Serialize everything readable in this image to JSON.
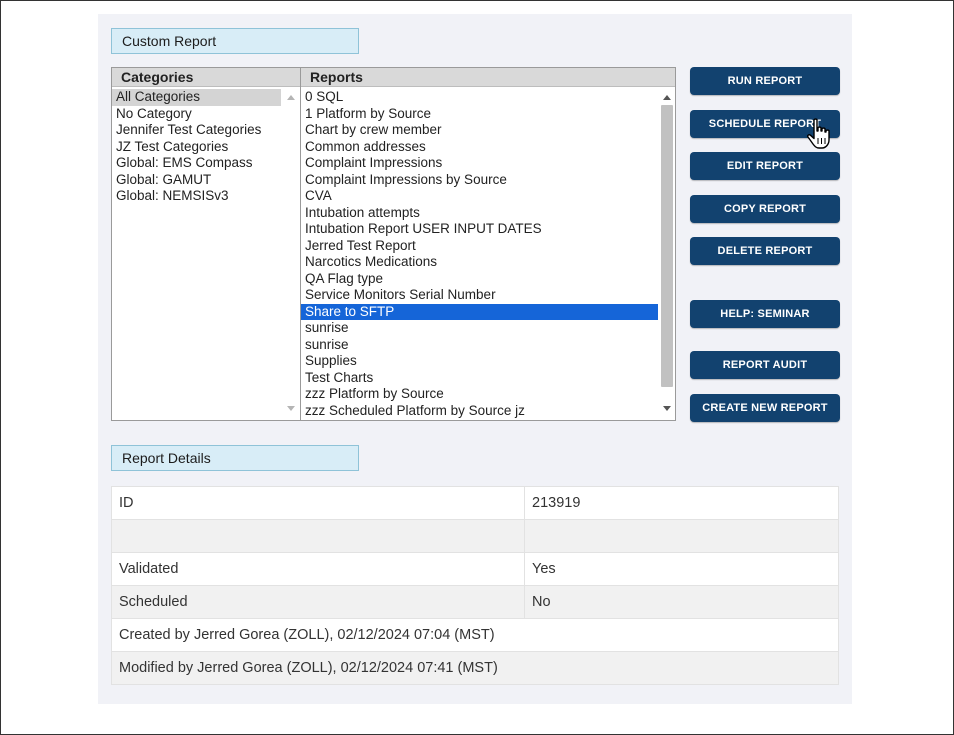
{
  "custom_report": {
    "header": "Custom Report",
    "categories_header": "Categories",
    "reports_header": "Reports",
    "categories": [
      {
        "label": "All Categories",
        "selected": true
      },
      {
        "label": "No Category"
      },
      {
        "label": "Jennifer Test Categories"
      },
      {
        "label": "JZ Test Categories"
      },
      {
        "label": "Global: EMS Compass"
      },
      {
        "label": "Global: GAMUT"
      },
      {
        "label": "Global: NEMSISv3"
      }
    ],
    "reports": [
      {
        "label": "0 SQL"
      },
      {
        "label": "1 Platform by Source"
      },
      {
        "label": "Chart by crew member"
      },
      {
        "label": "Common addresses"
      },
      {
        "label": "Complaint Impressions"
      },
      {
        "label": "Complaint Impressions by Source"
      },
      {
        "label": "CVA"
      },
      {
        "label": "Intubation attempts"
      },
      {
        "label": "Intubation Report USER INPUT DATES"
      },
      {
        "label": "Jerred Test Report"
      },
      {
        "label": "Narcotics Medications"
      },
      {
        "label": "QA Flag type"
      },
      {
        "label": "Service Monitors Serial Number"
      },
      {
        "label": "Share to SFTP",
        "selected": true
      },
      {
        "label": "sunrise"
      },
      {
        "label": "sunrise"
      },
      {
        "label": "Supplies"
      },
      {
        "label": "Test Charts"
      },
      {
        "label": "zzz Platform by Source"
      },
      {
        "label": "zzz Scheduled Platform by Source jz"
      }
    ]
  },
  "actions": {
    "run": "RUN REPORT",
    "schedule": "SCHEDULE REPORT",
    "edit": "EDIT REPORT",
    "copy": "COPY REPORT",
    "delete": "DELETE REPORT",
    "help": "HELP: SEMINAR",
    "audit": "REPORT AUDIT",
    "create": "CREATE NEW REPORT"
  },
  "report_details": {
    "header": "Report Details",
    "id_label": "ID",
    "id_value": "213919",
    "blank_label": "",
    "blank_value": "",
    "validated_label": "Validated",
    "validated_value": "Yes",
    "scheduled_label": "Scheduled",
    "scheduled_value": "No",
    "created": "Created by Jerred Gorea (ZOLL), 02/12/2024 07:04 (MST)",
    "modified": "Modified by Jerred Gorea (ZOLL), 02/12/2024 07:41 (MST)"
  },
  "colors": {
    "button": "#12426f",
    "selected_report": "#1565d8",
    "section_header": "#d8edf7"
  },
  "icons": {
    "cursor": "hand-pointer-icon"
  }
}
